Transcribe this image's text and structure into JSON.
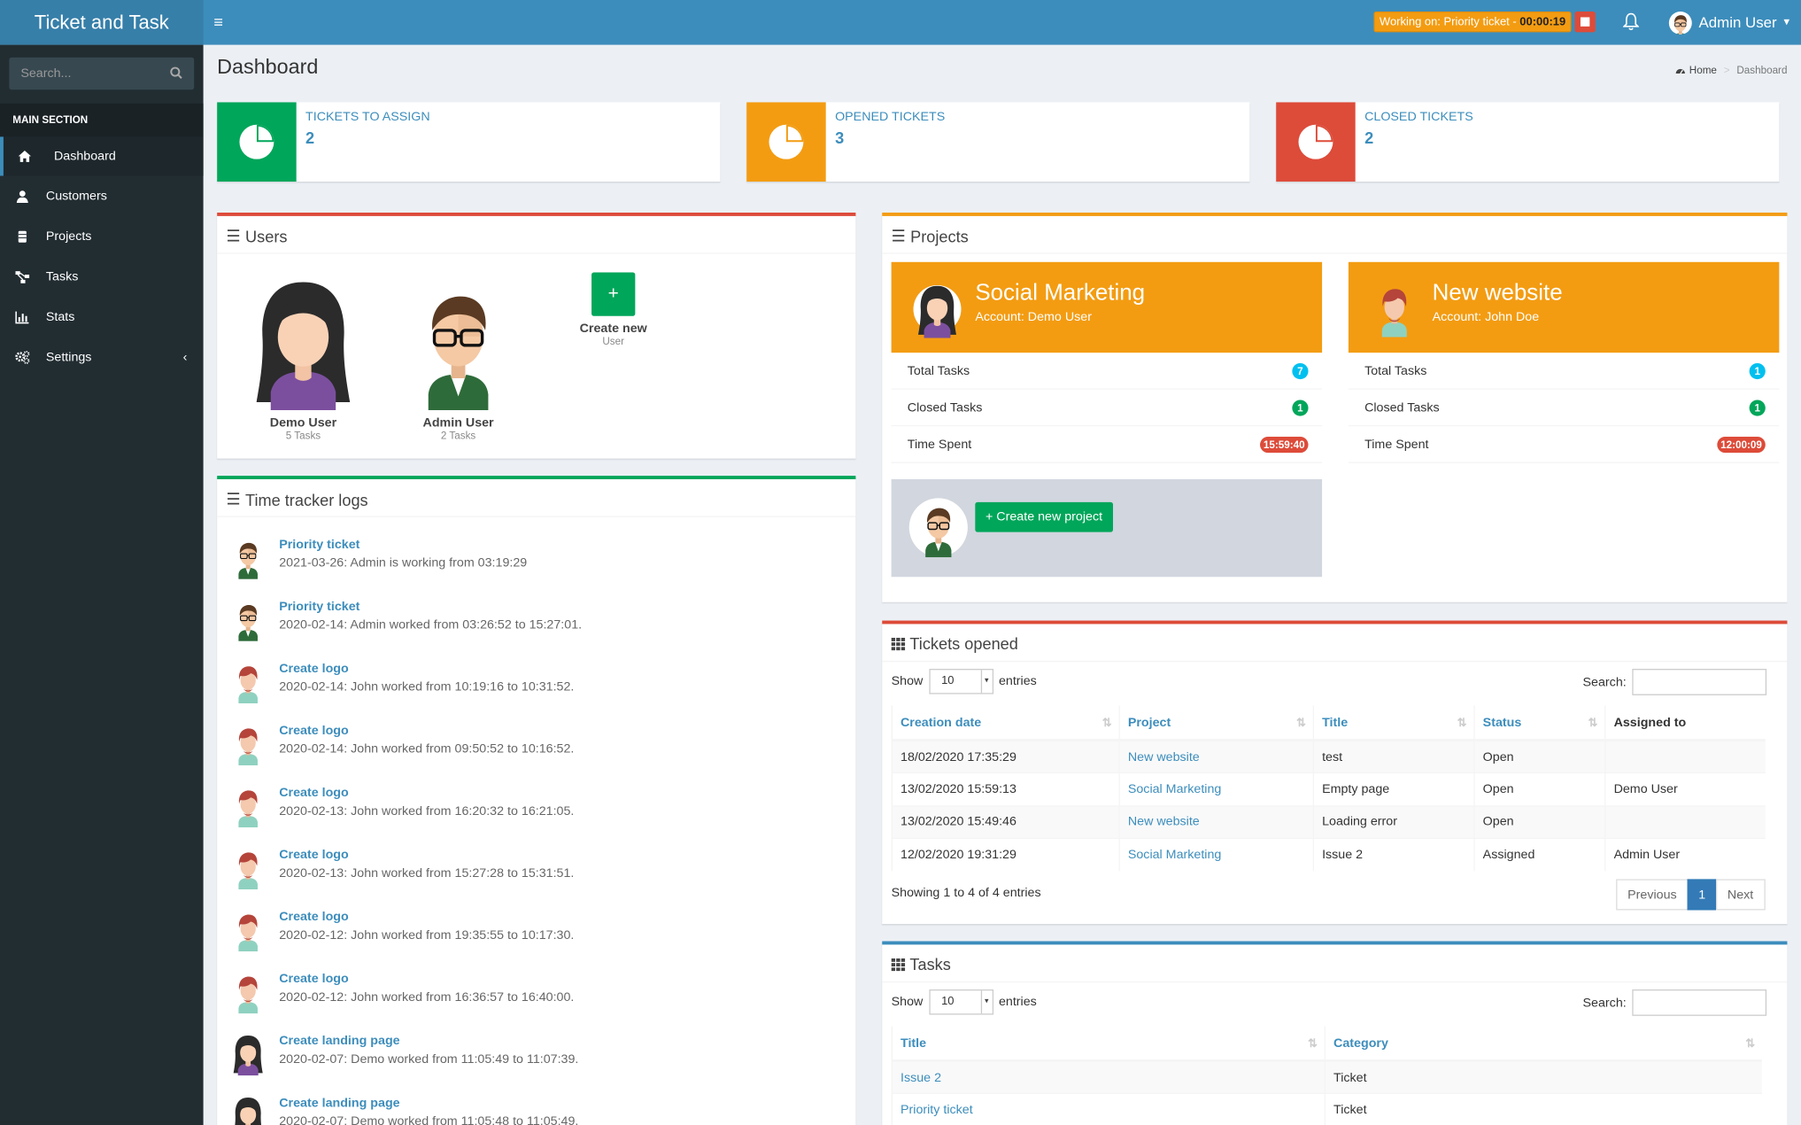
{
  "app": {
    "title": "Ticket and Task"
  },
  "header": {
    "working_label": "Working on: Priority ticket - ",
    "working_time": "00:00:19",
    "user_name": "Admin User"
  },
  "sidebar": {
    "search_placeholder": "Search...",
    "section_label": "MAIN SECTION",
    "items": [
      {
        "label": "Dashboard",
        "icon": "home-icon"
      },
      {
        "label": "Customers",
        "icon": "user-icon"
      },
      {
        "label": "Projects",
        "icon": "cube-icon"
      },
      {
        "label": "Tasks",
        "icon": "sitemap-icon"
      },
      {
        "label": "Stats",
        "icon": "bar-chart-icon"
      },
      {
        "label": "Settings",
        "icon": "gears-icon"
      }
    ]
  },
  "page": {
    "title": "Dashboard",
    "breadcrumb": [
      "Home",
      "Dashboard"
    ]
  },
  "info_boxes": [
    {
      "label": "TICKETS TO ASSIGN",
      "value": "2",
      "color": "#00a65a"
    },
    {
      "label": "OPENED TICKETS",
      "value": "3",
      "color": "#f39c12"
    },
    {
      "label": "CLOSED TICKETS",
      "value": "2",
      "color": "#dd4b39"
    }
  ],
  "users_box": {
    "title": "Users",
    "users": [
      {
        "name": "Demo User",
        "tasks": "5 Tasks"
      },
      {
        "name": "Admin User",
        "tasks": "2 Tasks"
      }
    ],
    "create": {
      "symbol": "+",
      "label": "Create new",
      "sub": "User"
    }
  },
  "time_logs": {
    "title": "Time tracker logs",
    "entries": [
      {
        "title": "Priority ticket",
        "detail": "2021-03-26: Admin is working from 03:19:29",
        "avatar": "admin"
      },
      {
        "title": "Priority ticket",
        "detail": "2020-02-14: Admin worked from 03:26:52 to 15:27:01.",
        "avatar": "admin"
      },
      {
        "title": "Create logo",
        "detail": "2020-02-14: John worked from 10:19:16 to 10:31:52.",
        "avatar": "john"
      },
      {
        "title": "Create logo",
        "detail": "2020-02-14: John worked from 09:50:52 to 10:16:52.",
        "avatar": "john"
      },
      {
        "title": "Create logo",
        "detail": "2020-02-13: John worked from 16:20:32 to 16:21:05.",
        "avatar": "john"
      },
      {
        "title": "Create logo",
        "detail": "2020-02-13: John worked from 15:27:28 to 15:31:51.",
        "avatar": "john"
      },
      {
        "title": "Create logo",
        "detail": "2020-02-12: John worked from 19:35:55 to 10:17:30.",
        "avatar": "john"
      },
      {
        "title": "Create logo",
        "detail": "2020-02-12: John worked from 16:36:57 to 16:40:00.",
        "avatar": "john"
      },
      {
        "title": "Create landing page",
        "detail": "2020-02-07: Demo worked from 11:05:49 to 11:07:39.",
        "avatar": "demo"
      },
      {
        "title": "Create landing page",
        "detail": "2020-02-07: Demo worked from 11:05:48 to 11:05:49.",
        "avatar": "demo"
      }
    ]
  },
  "projects_box": {
    "title": "Projects",
    "projects": [
      {
        "name": "Social Marketing",
        "account": "Account: Demo User",
        "total_label": "Total Tasks",
        "total": "7",
        "closed_label": "Closed Tasks",
        "closed": "1",
        "time_label": "Time Spent",
        "time": "15:59:40"
      },
      {
        "name": "New website",
        "account": "Account: John Doe",
        "total_label": "Total Tasks",
        "total": "1",
        "closed_label": "Closed Tasks",
        "closed": "1",
        "time_label": "Time Spent",
        "time": "12:00:09"
      }
    ],
    "create_label": "+ Create new project"
  },
  "tickets_box": {
    "title": "Tickets opened",
    "show_label": "Show",
    "entries_value": "10",
    "entries_label": "entries",
    "search_label": "Search:",
    "columns": [
      "Creation date",
      "Project",
      "Title",
      "Status",
      "Assigned to"
    ],
    "rows": [
      [
        "18/02/2020 17:35:29",
        "New website",
        "test",
        "Open",
        ""
      ],
      [
        "13/02/2020 15:59:13",
        "Social Marketing",
        "Empty page",
        "Open",
        "Demo User"
      ],
      [
        "13/02/2020 15:49:46",
        "New website",
        "Loading error",
        "Open",
        ""
      ],
      [
        "12/02/2020 19:31:29",
        "Social Marketing",
        "Issue 2",
        "Assigned",
        "Admin User"
      ]
    ],
    "info": "Showing 1 to 4 of 4 entries",
    "pagination": [
      "Previous",
      "1",
      "Next"
    ]
  },
  "tasks_box": {
    "title": "Tasks",
    "show_label": "Show",
    "entries_value": "10",
    "entries_label": "entries",
    "search_label": "Search:",
    "columns": [
      "Title",
      "Category"
    ],
    "rows": [
      [
        "Issue 2",
        "Ticket"
      ],
      [
        "Priority ticket",
        "Ticket"
      ]
    ]
  }
}
